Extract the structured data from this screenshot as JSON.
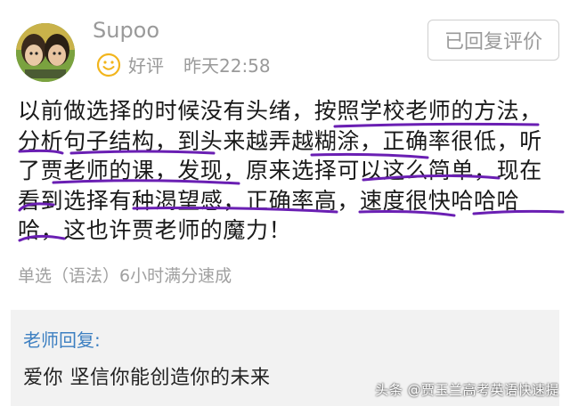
{
  "user": {
    "name": "Supoo",
    "rating": "好评",
    "time": "昨天22:58",
    "avatar_icon": "avatar-cartoon-icon",
    "rating_icon": "smile-icon"
  },
  "actions": {
    "reply_button": "已回复评价"
  },
  "review": {
    "text": "以前做选择的时候没有头绪，按照学校老师的方法，分析句子结构，到头来越弄越糊涂，正确率很低，听了贾老师的课，发现，原来选择可以这么简单，现在看到选择有种渴望感，正确率高，速度很快哈哈哈哈，这也许贾老师的魔力！"
  },
  "course": {
    "name": "单选（语法）6小时满分速成"
  },
  "teacher_reply": {
    "label": "老师回复:",
    "text": "爱你   坚信你能创造你的未来"
  },
  "watermark": {
    "text": "头条 @贾玉兰高考英语快速提"
  },
  "colors": {
    "underline": "#6a1fb3",
    "teacher_label": "#3c7fc1",
    "rating_icon": "#f2b51c",
    "muted_text": "#9a9a9a"
  }
}
